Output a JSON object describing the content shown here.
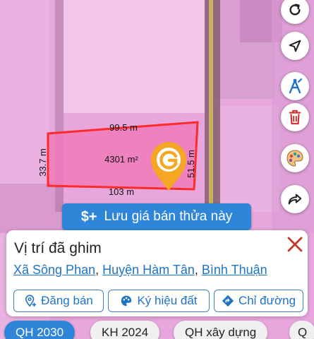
{
  "map": {
    "lengths": {
      "top": "99.5 m",
      "bottom": "103 m",
      "left": "33.7 m",
      "right": "51.5 m"
    },
    "area": "4301 m²",
    "pin_icon": "g-logo-pin-icon",
    "colors": {
      "boundary": "#ff2a2a",
      "parcel_fill": "#f07ab8",
      "land_pink": "#e7a7dc",
      "pin": "#f5a623"
    }
  },
  "toolbar": {
    "icons": [
      "refresh-icon",
      "location-arrow-icon",
      "measure-icon",
      "trash-icon",
      "palette-icon",
      "share-icon"
    ]
  },
  "save_button": {
    "icon": "$+",
    "label": "Lưu giá bán thửa này"
  },
  "card": {
    "title": "Vị trí đã ghim",
    "address": {
      "commune": "Xã Sông Phan",
      "sep1": ", ",
      "district": "Huyện Hàm Tân",
      "sep2": ", ",
      "province": "Bình Thuận"
    },
    "actions": {
      "sell": "Đăng bán",
      "symbol": "Ký hiệu đất",
      "directions": "Chỉ đường"
    }
  },
  "chips": [
    "QH 2030",
    "KH 2024",
    "QH xây dựng",
    "Q"
  ]
}
